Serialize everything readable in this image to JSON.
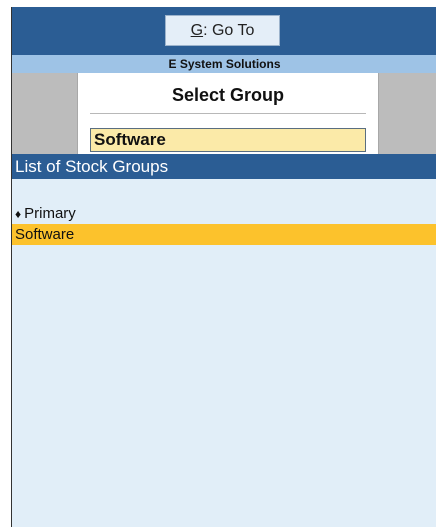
{
  "goto": {
    "key": "G",
    "label": ": Go To"
  },
  "company": "E System Solutions",
  "select_group": {
    "title": "Select Group",
    "value": "Software"
  },
  "list": {
    "header": "List of Stock Groups",
    "items": [
      {
        "label": "Primary",
        "bullet": "♦",
        "selected": false
      },
      {
        "label": "Software",
        "bullet": "",
        "selected": true
      }
    ]
  },
  "colors": {
    "title_bar": "#2b5d94",
    "company_bar": "#9ec3e6",
    "highlight": "#fcc22c",
    "input_bg": "#fbeaa8",
    "content_bg": "#e1eef8"
  }
}
